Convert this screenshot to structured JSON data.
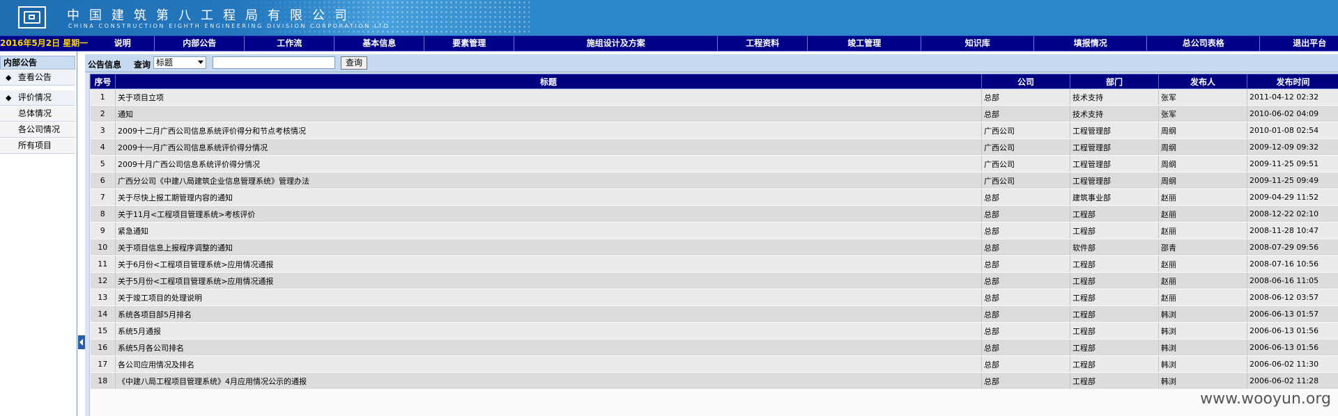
{
  "header": {
    "company_cn": "中国建筑第八工程局有限公司",
    "company_en": "CHINA CONSTRUCTION EIGHTH ENGINEERING DIVISION CORPORATION LTD",
    "logo": "cscec-logo"
  },
  "nav": {
    "date": "2016年5月2日 星期一",
    "items": [
      {
        "label": "说明"
      },
      {
        "label": "内部公告"
      },
      {
        "label": "工作流"
      },
      {
        "label": "基本信息"
      },
      {
        "label": "要素管理"
      },
      {
        "label": "施组设计及方案"
      },
      {
        "label": "工程资料"
      },
      {
        "label": "竣工管理"
      },
      {
        "label": "知识库"
      },
      {
        "label": "填报情况"
      },
      {
        "label": "总公司表格"
      },
      {
        "label": "退出平台"
      }
    ]
  },
  "sidebar": {
    "title": "内部公告",
    "items": [
      {
        "label": "查看公告",
        "bullet": "◆"
      },
      {
        "label": "评价情况",
        "bullet": "◆"
      },
      {
        "label": "总体情况"
      },
      {
        "label": "各公司情况"
      },
      {
        "label": "所有项目"
      }
    ]
  },
  "toolbar": {
    "title": "公告信息",
    "query_label": "查询",
    "select_value": "标题",
    "search_value": "",
    "button_label": "查询"
  },
  "table": {
    "columns": [
      "序号",
      "标题",
      "公司",
      "部门",
      "发布人",
      "发布时间"
    ],
    "rows": [
      [
        "1",
        "关于项目立项",
        "总部",
        "技术支持",
        "张军",
        "2011-04-12 02:32"
      ],
      [
        "2",
        "通知",
        "总部",
        "技术支持",
        "张军",
        "2010-06-02 04:09"
      ],
      [
        "3",
        "2009十二月广西公司信息系统评价得分和节点考核情况",
        "广西公司",
        "工程管理部",
        "周纲",
        "2010-01-08 02:54"
      ],
      [
        "4",
        "2009十一月广西公司信息系统评价得分情况",
        "广西公司",
        "工程管理部",
        "周纲",
        "2009-12-09 09:32"
      ],
      [
        "5",
        "2009十月广西公司信息系统评价得分情况",
        "广西公司",
        "工程管理部",
        "周纲",
        "2009-11-25 09:51"
      ],
      [
        "6",
        "广西分公司《中建八局建筑企业信息管理系统》管理办法",
        "广西公司",
        "工程管理部",
        "周纲",
        "2009-11-25 09:49"
      ],
      [
        "7",
        "关于尽快上报工期管理内容的通知",
        "总部",
        "建筑事业部",
        "赵丽",
        "2009-04-29 11:52"
      ],
      [
        "8",
        "关于11月<工程项目管理系统>考核评价",
        "总部",
        "工程部",
        "赵丽",
        "2008-12-22 02:10"
      ],
      [
        "9",
        "紧急通知",
        "总部",
        "工程部",
        "赵丽",
        "2008-11-28 10:47"
      ],
      [
        "10",
        "关于项目信息上报程序调整的通知",
        "总部",
        "软件部",
        "邵青",
        "2008-07-29 09:56"
      ],
      [
        "11",
        "关于6月份<工程项目管理系统>应用情况通报",
        "总部",
        "工程部",
        "赵丽",
        "2008-07-16 10:56"
      ],
      [
        "12",
        "关于5月份<工程项目管理系统>应用情况通报",
        "总部",
        "工程部",
        "赵丽",
        "2008-06-16 11:05"
      ],
      [
        "13",
        "关于竣工项目的处理说明",
        "总部",
        "工程部",
        "赵丽",
        "2008-06-12 03:57"
      ],
      [
        "14",
        "系统各项目部5月排名",
        "总部",
        "工程部",
        "韩浏",
        "2006-06-13 01:57"
      ],
      [
        "15",
        "系统5月通报",
        "总部",
        "工程部",
        "韩浏",
        "2006-06-13 01:56"
      ],
      [
        "16",
        "系统5月各公司排名",
        "总部",
        "工程部",
        "韩浏",
        "2006-06-13 01:56"
      ],
      [
        "17",
        "各公司应用情况及排名",
        "总部",
        "工程部",
        "韩浏",
        "2006-06-02 11:30"
      ],
      [
        "18",
        "《中建八局工程项目管理系统》4月应用情况公示的通报",
        "总部",
        "工程部",
        "韩浏",
        "2006-06-02 11:28"
      ]
    ]
  },
  "watermark": "www.wooyun.org",
  "colors": {
    "banner": "#2e87c8",
    "nav_bg": "#000088",
    "nav_date": "#ffd400",
    "table_header": "#000080",
    "row_odd": "#eaeaea",
    "row_even": "#dcdcdc"
  }
}
